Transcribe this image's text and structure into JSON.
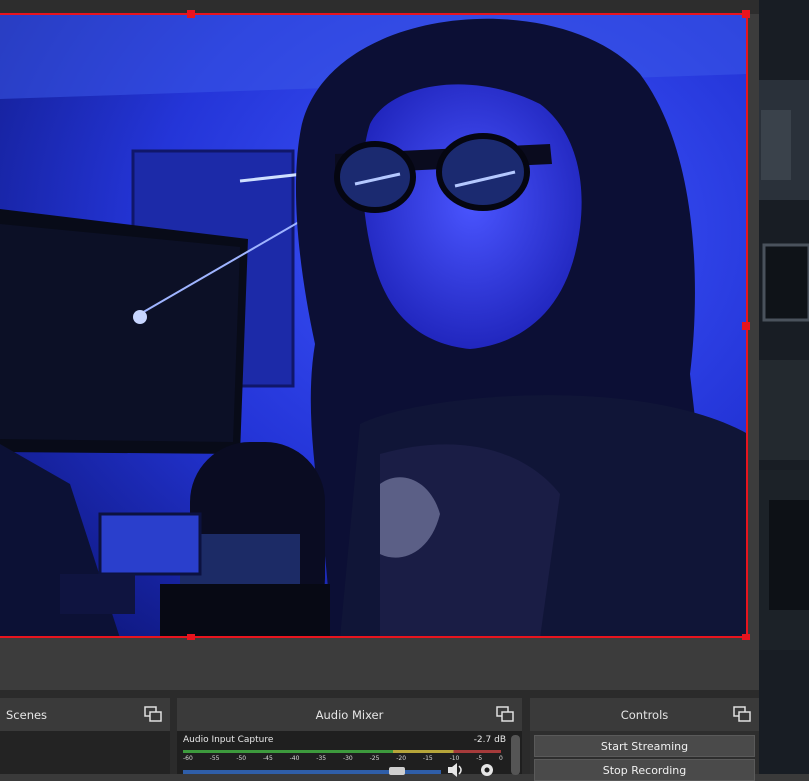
{
  "docks": {
    "scenes": {
      "title": "Scenes"
    },
    "audio_mixer": {
      "title": "Audio Mixer",
      "sources": [
        {
          "name": "Audio Input Capture",
          "level": "-2.7 dB"
        }
      ],
      "ticks": [
        "-60",
        "-55",
        "-50",
        "-45",
        "-40",
        "-35",
        "-30",
        "-25",
        "-20",
        "-15",
        "-10",
        "-5",
        "0"
      ]
    },
    "controls": {
      "title": "Controls",
      "buttons": [
        "Start Streaming",
        "Stop Recording"
      ]
    }
  },
  "colors": {
    "selection": "#e8141e",
    "dock_header": "#3a3a3a",
    "button": "#4a4a4a"
  },
  "icons": {
    "undock": "undock-icon",
    "speaker": "speaker-icon",
    "gear": "gear-icon"
  }
}
